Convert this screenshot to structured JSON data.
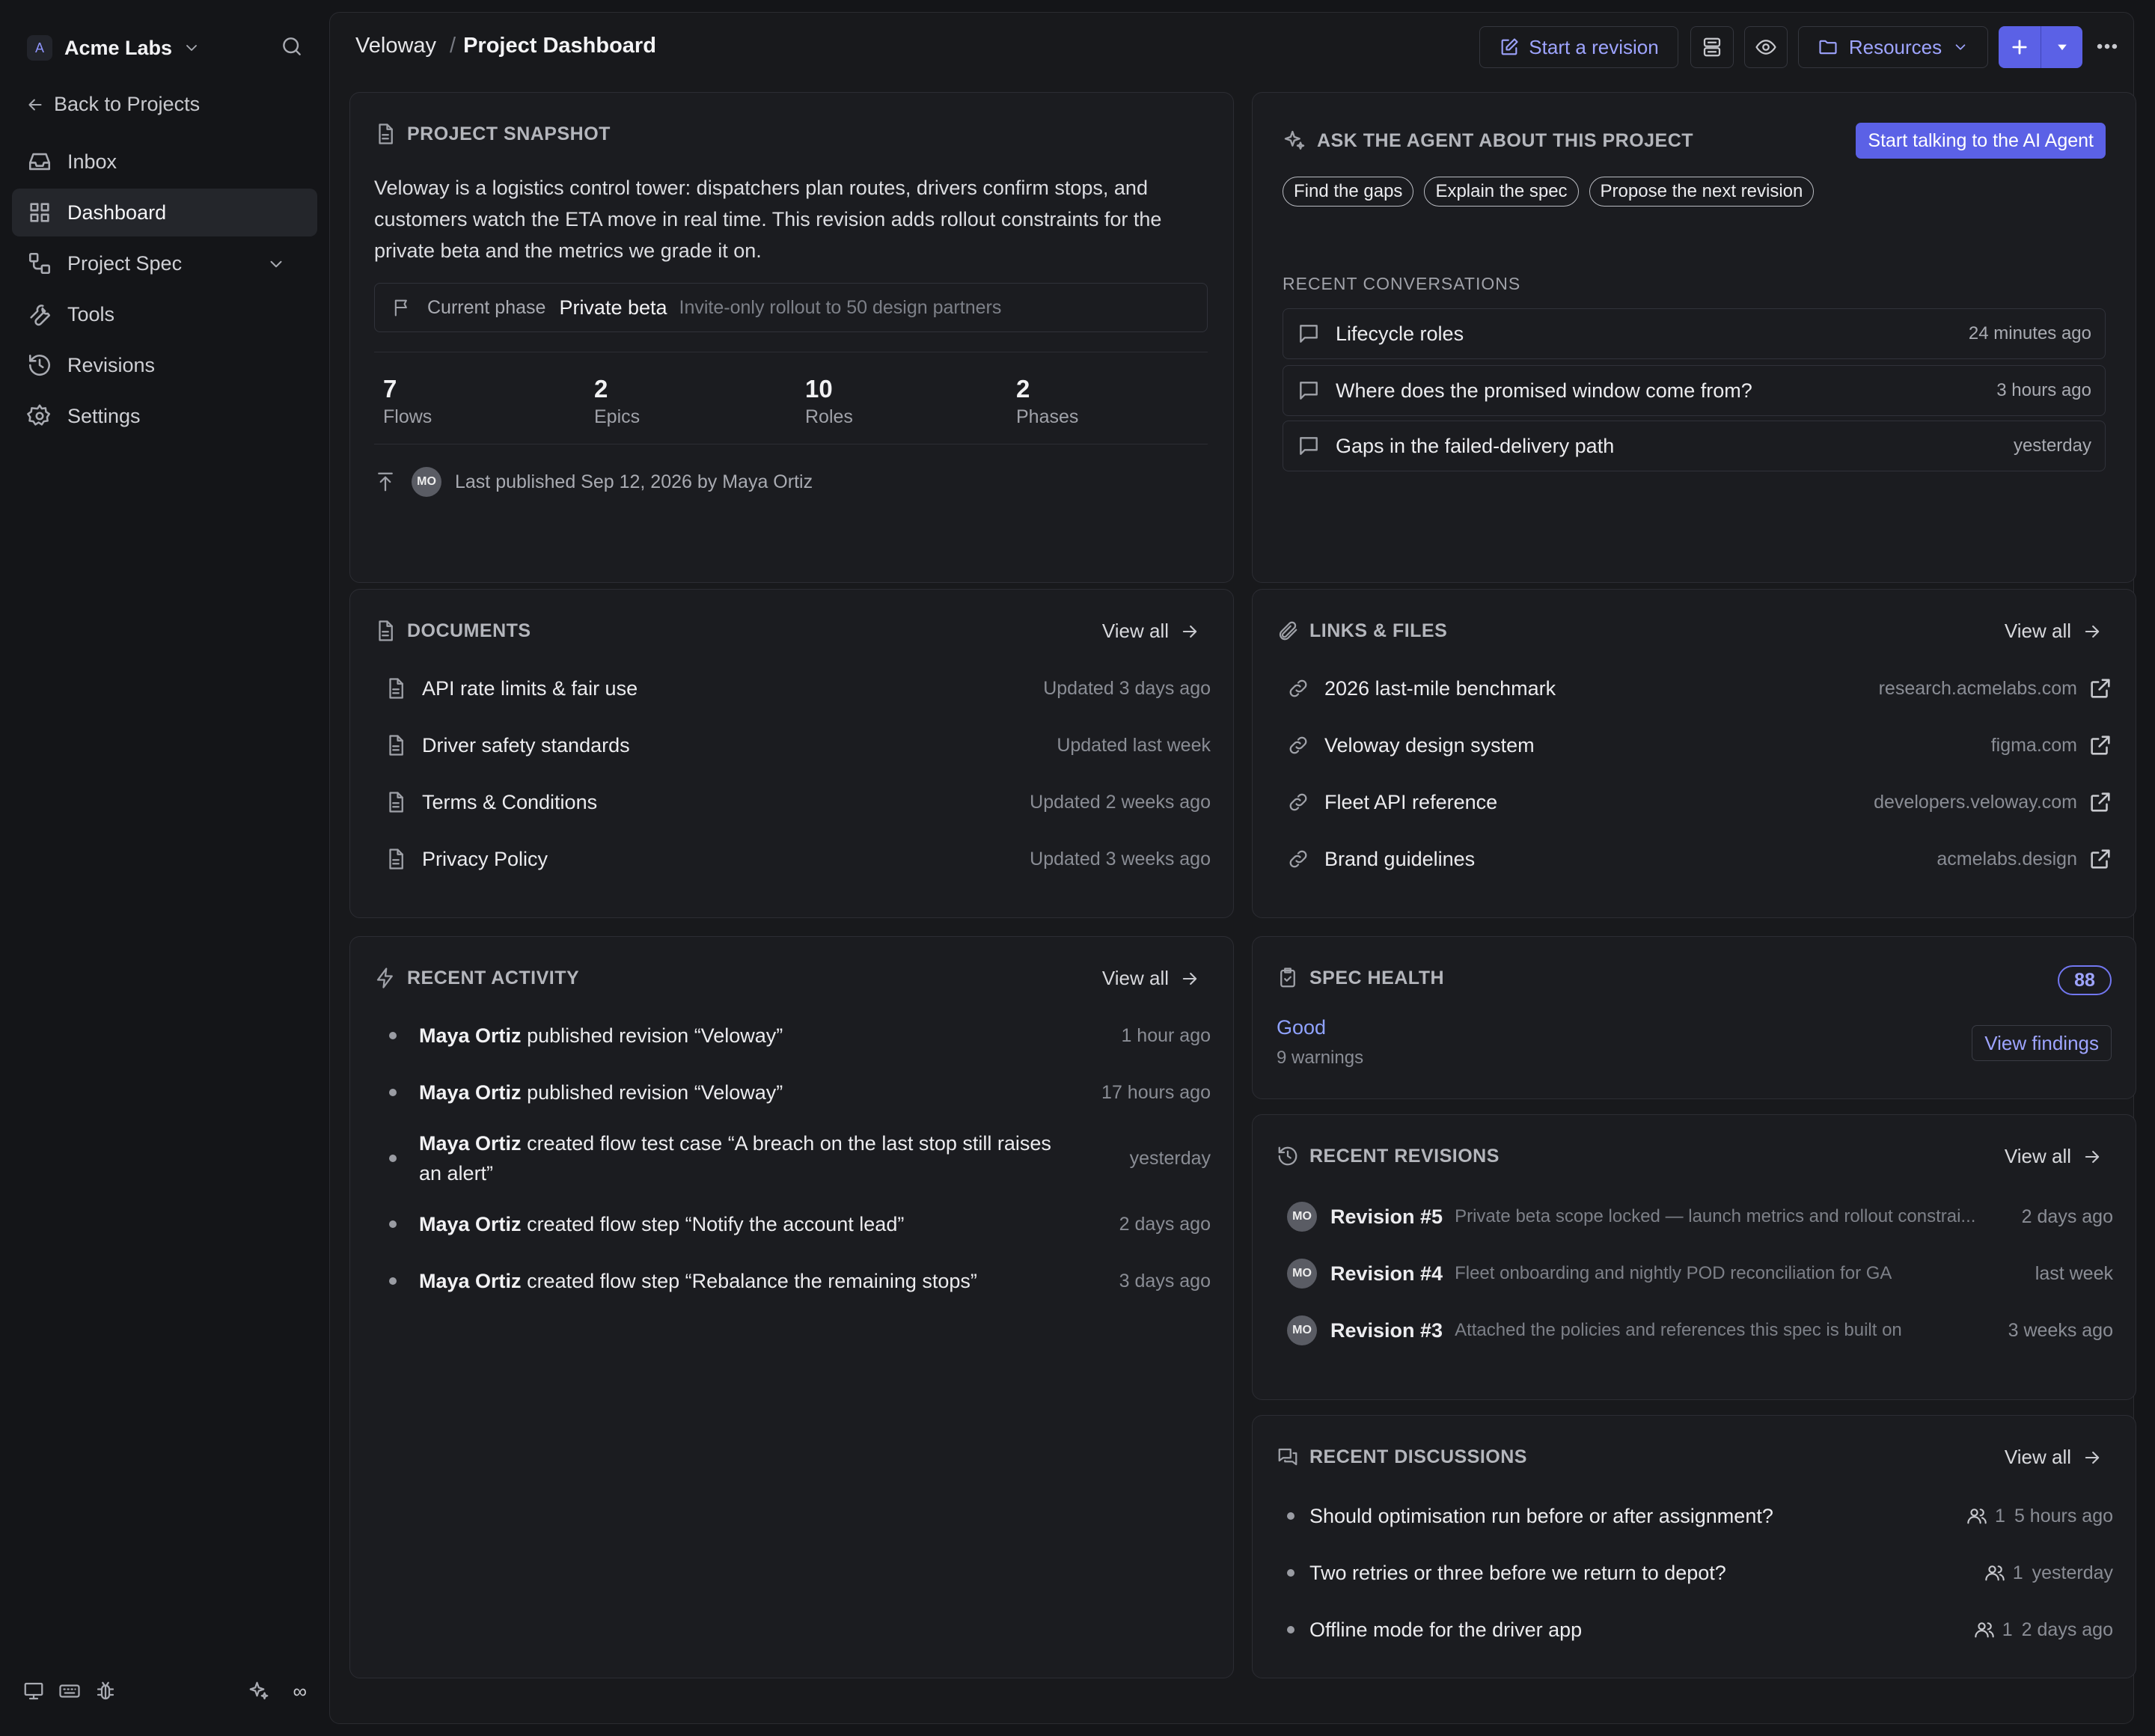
{
  "sidebar": {
    "workspace_initial": "A",
    "workspace_name": "Acme Labs",
    "back_label": "Back to Projects",
    "items": [
      {
        "label": "Inbox"
      },
      {
        "label": "Dashboard"
      },
      {
        "label": "Project Spec"
      },
      {
        "label": "Tools"
      },
      {
        "label": "Revisions"
      },
      {
        "label": "Settings"
      }
    ],
    "footer_infinity": "∞"
  },
  "header": {
    "breadcrumb_project": "Veloway",
    "breadcrumb_sep": "/",
    "breadcrumb_page": "Project Dashboard",
    "start_revision": "Start a revision",
    "resources": "Resources"
  },
  "snapshot": {
    "title": "PROJECT SNAPSHOT",
    "description": "Veloway is a logistics control tower: dispatchers plan routes, drivers confirm stops, and customers watch the ETA move in real time. This revision adds rollout constraints for the private beta and the metrics we grade it on.",
    "phase_label": "Current phase",
    "phase_value": "Private beta",
    "phase_desc": "Invite-only rollout to 50 design partners",
    "stats": [
      {
        "value": "7",
        "label": "Flows"
      },
      {
        "value": "2",
        "label": "Epics"
      },
      {
        "value": "10",
        "label": "Roles"
      },
      {
        "value": "2",
        "label": "Phases"
      }
    ],
    "avatar": "MO",
    "published": "Last published Sep 12, 2026 by Maya Ortiz"
  },
  "agent": {
    "title": "ASK THE AGENT ABOUT THIS PROJECT",
    "button": "Start talking to the AI Agent",
    "chips": [
      "Find the gaps",
      "Explain the spec",
      "Propose the next revision"
    ],
    "recent_label": "RECENT CONVERSATIONS",
    "conversations": [
      {
        "title": "Lifecycle roles",
        "time": "24 minutes ago"
      },
      {
        "title": "Where does the promised window come from?",
        "time": "3 hours ago"
      },
      {
        "title": "Gaps in the failed-delivery path",
        "time": "yesterday"
      }
    ]
  },
  "view_all": "View all",
  "documents": {
    "title": "DOCUMENTS",
    "items": [
      {
        "title": "API rate limits & fair use",
        "meta": "Updated 3 days ago"
      },
      {
        "title": "Driver safety standards",
        "meta": "Updated last week"
      },
      {
        "title": "Terms & Conditions",
        "meta": "Updated 2 weeks ago"
      },
      {
        "title": "Privacy Policy",
        "meta": "Updated 3 weeks ago"
      }
    ]
  },
  "links": {
    "title": "LINKS & FILES",
    "items": [
      {
        "title": "2026 last-mile benchmark",
        "domain": "research.acmelabs.com"
      },
      {
        "title": "Veloway design system",
        "domain": "figma.com"
      },
      {
        "title": "Fleet API reference",
        "domain": "developers.veloway.com"
      },
      {
        "title": "Brand guidelines",
        "domain": "acmelabs.design"
      }
    ]
  },
  "activity": {
    "title": "RECENT ACTIVITY",
    "items": [
      {
        "actor": "Maya Ortiz",
        "text": "published revision “Veloway”",
        "time": "1 hour ago"
      },
      {
        "actor": "Maya Ortiz",
        "text": "published revision “Veloway”",
        "time": "17 hours ago"
      },
      {
        "actor": "Maya Ortiz",
        "text": "created flow test case “A breach on the last stop still raises an alert”",
        "time": "yesterday"
      },
      {
        "actor": "Maya Ortiz",
        "text": "created flow step “Notify the account lead”",
        "time": "2 days ago"
      },
      {
        "actor": "Maya Ortiz",
        "text": "created flow step “Rebalance the remaining stops”",
        "time": "3 days ago"
      }
    ]
  },
  "health": {
    "title": "SPEC HEALTH",
    "score": "88",
    "status": "Good",
    "warnings": "9 warnings",
    "button": "View findings"
  },
  "revisions": {
    "title": "RECENT REVISIONS",
    "items": [
      {
        "avatar": "MO",
        "name": "Revision #5",
        "desc": "Private beta scope locked — launch metrics and rollout constrai...",
        "time": "2 days ago"
      },
      {
        "avatar": "MO",
        "name": "Revision #4",
        "desc": "Fleet onboarding and nightly POD reconciliation for GA",
        "time": "last week"
      },
      {
        "avatar": "MO",
        "name": "Revision #3",
        "desc": "Attached the policies and references this spec is built on",
        "time": "3 weeks ago"
      }
    ]
  },
  "discussions": {
    "title": "RECENT DISCUSSIONS",
    "items": [
      {
        "title": "Should optimisation run before or after assignment?",
        "count": "1",
        "time": "5 hours ago"
      },
      {
        "title": "Two retries or three before we return to depot?",
        "count": "1",
        "time": "yesterday"
      },
      {
        "title": "Offline mode for the driver app",
        "count": "1",
        "time": "2 days ago"
      }
    ]
  }
}
